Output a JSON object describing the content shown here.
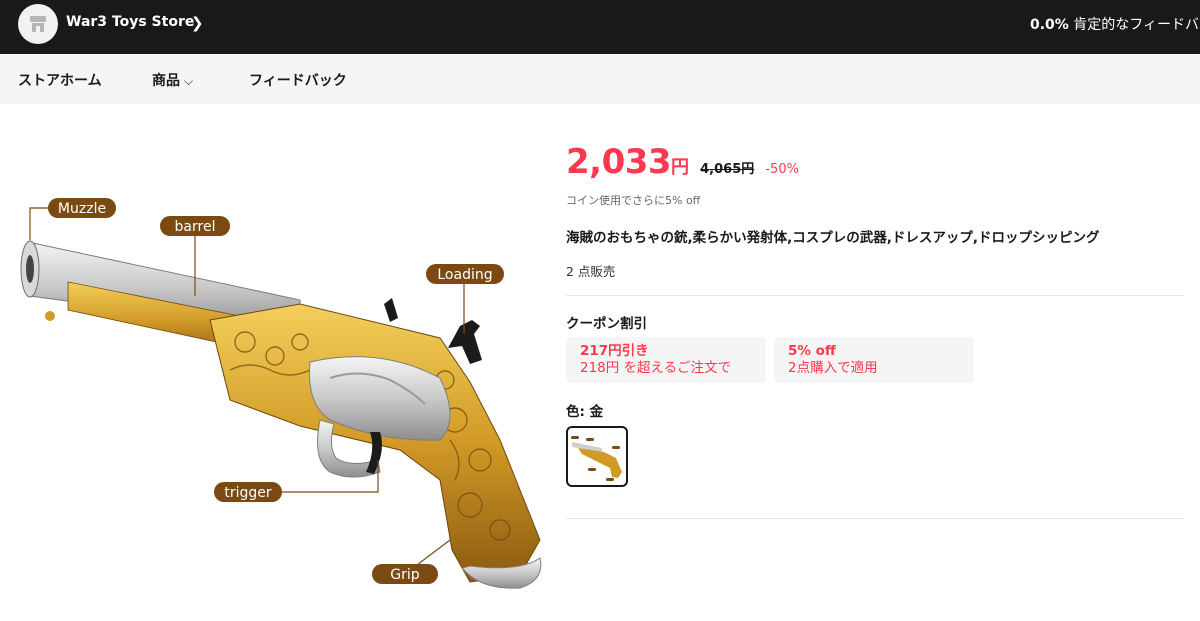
{
  "store": {
    "name": "War3 Toys Store",
    "feedback_percent": "0.0%",
    "feedback_label": "肯定的なフィードバ"
  },
  "nav": {
    "home": "ストアホーム",
    "products": "商品",
    "feedback": "フィードバック"
  },
  "image_labels": {
    "muzzle": "Muzzle",
    "barrel": "barrel",
    "loading": "Loading",
    "trigger": "trigger",
    "grip": "Grip"
  },
  "product": {
    "price": "2,033",
    "currency": "円",
    "original_price": "4,065円",
    "discount": "-50%",
    "coin_note": "コイン使用でさらに5% off",
    "title": "海賊のおもちゃの銃,柔らかい発射体,コスプレの武器,ドレスアップ,ドロップシッピング",
    "sold": "2 点販売"
  },
  "coupons": {
    "heading": "クーポン割引",
    "items": [
      {
        "title": "217円引き",
        "desc": "218円 を超えるご注文で"
      },
      {
        "title": "5% off",
        "desc": "2点購入で適用"
      }
    ]
  },
  "color": {
    "label": "色: 金"
  },
  "colors": {
    "accent": "#fd384f",
    "topbar": "#191919",
    "navbar": "#f5f5f5",
    "label_brown": "#7a4a12"
  }
}
